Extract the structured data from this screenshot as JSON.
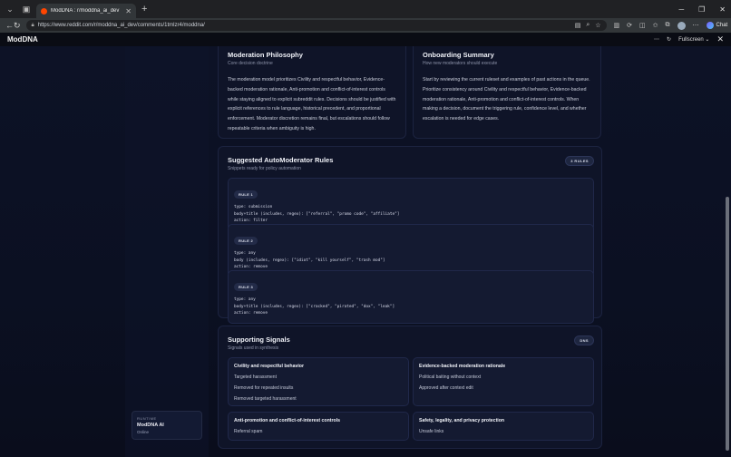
{
  "browser": {
    "tab_title": "ModDNA : r/moddna_ai_dev",
    "url": "https://www.reddit.com/r/moddna_ai_dev/comments/1tmlzr4/moddna/",
    "chat_label": "Chat"
  },
  "app": {
    "title": "ModDNA",
    "fullscreen_label": "Fullscreen"
  },
  "runtime": {
    "label": "RUNTIME",
    "name": "ModDNA AI",
    "status": "Online"
  },
  "philosophy": {
    "title": "Moderation Philosophy",
    "subtitle": "Core decision doctrine",
    "body": "The moderation model prioritizes Civility and respectful behavior, Evidence-backed moderation rationale, Anti-promotion and conflict-of-interest controls while staying aligned to explicit subreddit rules. Decisions should be justified with explicit references to rule language, historical precedent, and proportional enforcement. Moderator discretion remains final, but escalations should follow repeatable criteria when ambiguity is high."
  },
  "onboarding": {
    "title": "Onboarding Summary",
    "subtitle": "How new moderators should execute",
    "body": "Start by reviewing the current ruleset and examples of past actions in the queue. Prioritize consistency around Civility and respectful behavior, Evidence-backed moderation rationale, Anti-promotion and conflict-of-interest controls. When making a decision, document the triggering rule, confidence level, and whether escalation is needed for edge cases."
  },
  "automod": {
    "title": "Suggested AutoModerator Rules",
    "subtitle": "Snippets ready for policy automation",
    "badge": "3 RULES",
    "rules": [
      {
        "label": "RULE 1",
        "code": "type: submission\nbody+title (includes, regex): [\"referral\", \"promo code\", \"affiliate\"]\naction: filter"
      },
      {
        "label": "RULE 2",
        "code": "type: any\nbody (includes, regex): [\"idiot\", \"kill yourself\", \"trash mod\"]\naction: remove"
      },
      {
        "label": "RULE 3",
        "code": "type: any\nbody+title (includes, regex): [\"cracked\", \"pirated\", \"dox\", \"leak\"]\naction: remove"
      }
    ]
  },
  "signals": {
    "title": "Supporting Signals",
    "subtitle": "Signals used in synthesis",
    "badge": "DNS",
    "groups": [
      {
        "heading": "Civility and respectful behavior",
        "items": [
          "Targeted harassment",
          "Removed for repeated insults",
          "Removed targeted harassment"
        ]
      },
      {
        "heading": "Evidence-backed moderation rationale",
        "items": [
          "Political baiting without context",
          "Approved after context edit"
        ]
      },
      {
        "heading": "Anti-promotion and conflict-of-interest controls",
        "items": [
          "Referral spam"
        ]
      },
      {
        "heading": "Safety, legality, and privacy protection",
        "items": [
          "Unsafe links"
        ]
      }
    ]
  }
}
